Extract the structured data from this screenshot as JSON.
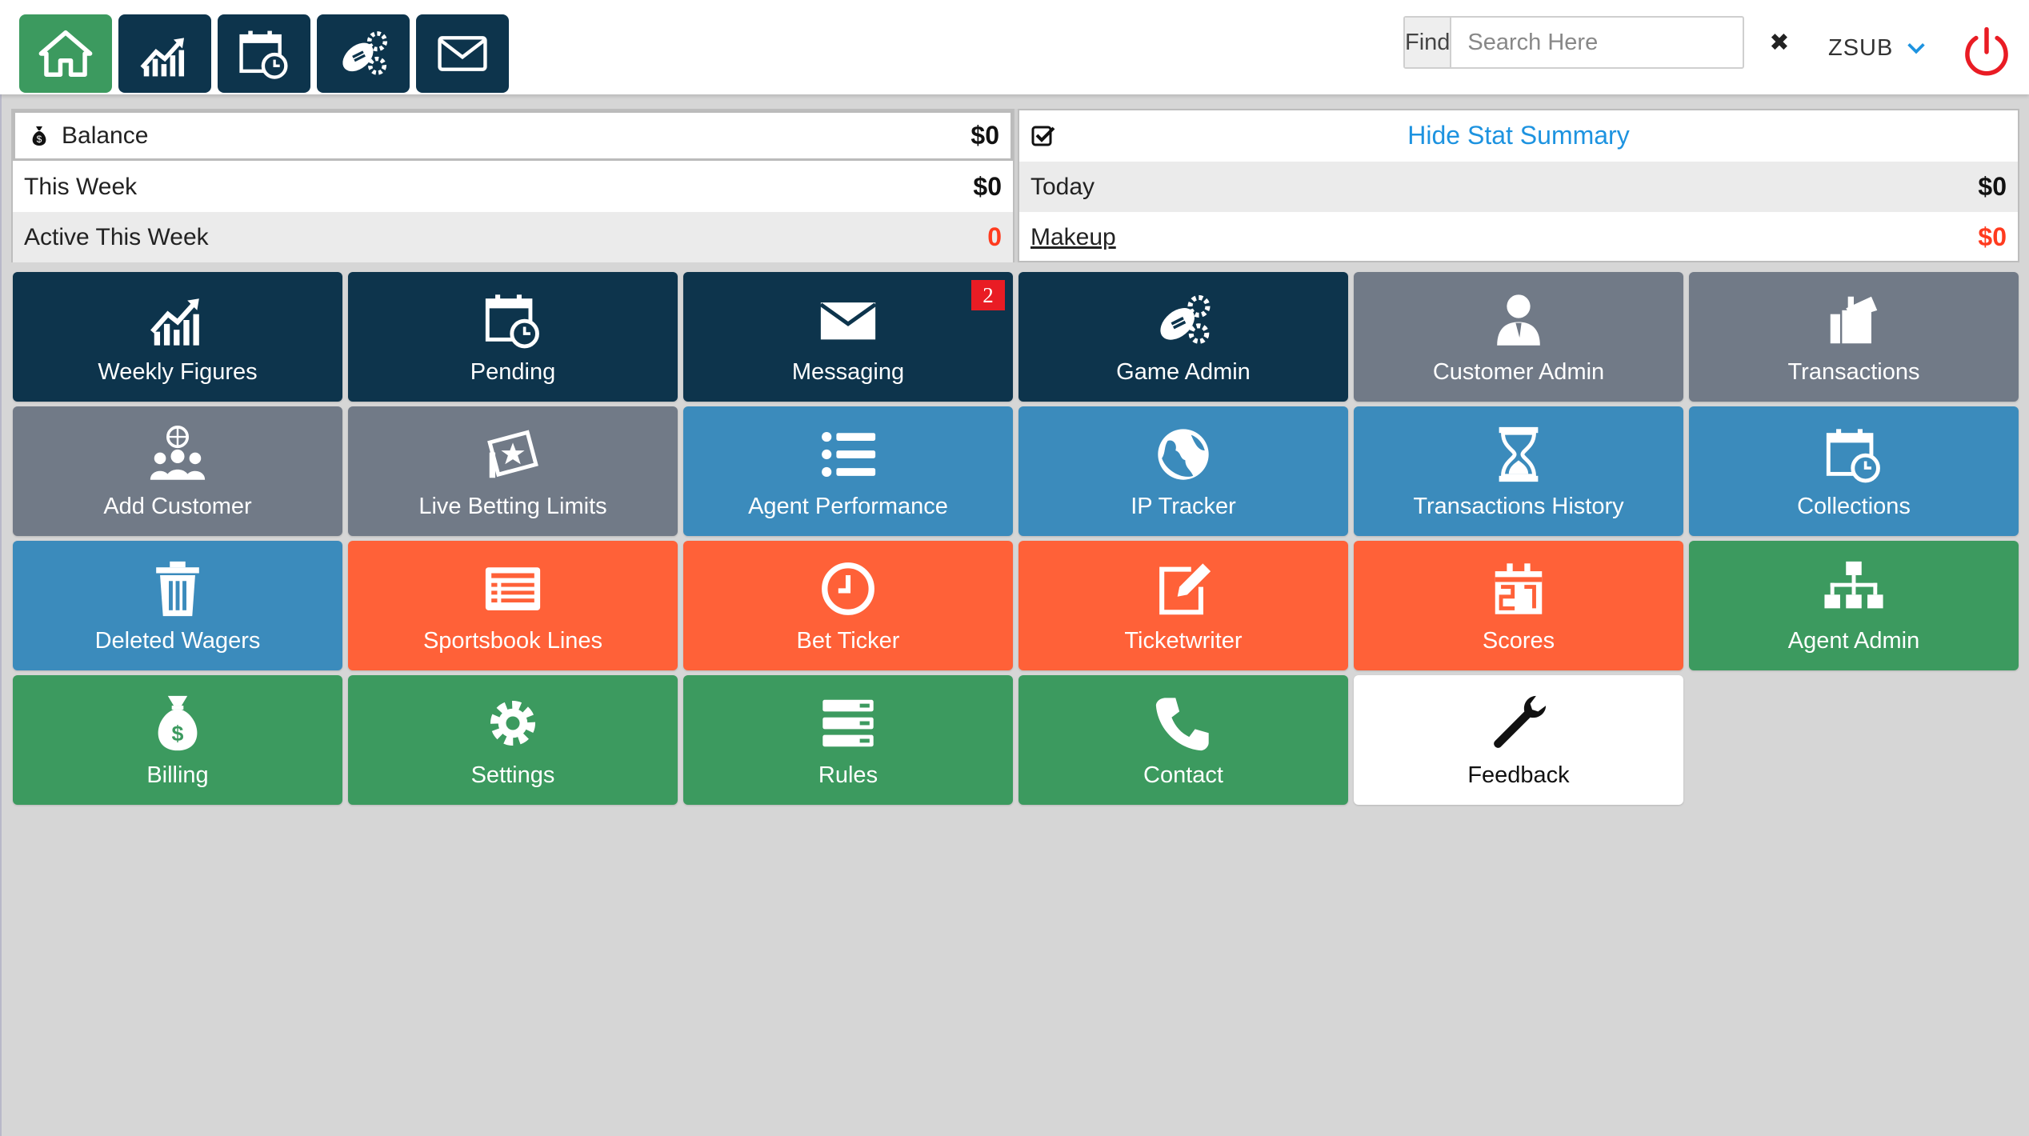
{
  "colors": {
    "navy": "#0d344c",
    "green": "#3c9a5f",
    "grey": "#717a87",
    "blue": "#3b8bbc",
    "orange": "#ff6138",
    "link": "#1d93e0",
    "alert_red": "#e91c24"
  },
  "topnav": {
    "buttons": [
      {
        "name": "home",
        "icon": "home-icon"
      },
      {
        "name": "weekly-figures",
        "icon": "chart-up-icon"
      },
      {
        "name": "pending",
        "icon": "calendar-clock-icon"
      },
      {
        "name": "game-admin",
        "icon": "football-gears-icon"
      },
      {
        "name": "messaging",
        "icon": "envelope-icon"
      }
    ],
    "find_label": "Find",
    "search_placeholder": "Search Here",
    "clear_symbol": "✖",
    "user": "ZSUB"
  },
  "stats": {
    "balance_label": "Balance",
    "balance_value": "$0",
    "this_week_label": "This Week",
    "this_week_value": "$0",
    "active_label": "Active This Week",
    "active_value": "0",
    "hide_link": "Hide Stat Summary",
    "today_label": "Today",
    "today_value": "$0",
    "makeup_label": "Makeup",
    "makeup_value": "$0"
  },
  "tiles": [
    {
      "label": "Weekly Figures",
      "icon": "chart-up-icon",
      "color": "navy"
    },
    {
      "label": "Pending",
      "icon": "calendar-clock-icon",
      "color": "navy"
    },
    {
      "label": "Messaging",
      "icon": "envelope-icon",
      "color": "navy",
      "badge": "2"
    },
    {
      "label": "Game Admin",
      "icon": "football-gears-icon",
      "color": "navy"
    },
    {
      "label": "Customer Admin",
      "icon": "user-tie-icon",
      "color": "grey"
    },
    {
      "label": "Transactions",
      "icon": "tickets-icon",
      "color": "grey"
    },
    {
      "label": "Add Customer",
      "icon": "users-globe-icon",
      "color": "grey"
    },
    {
      "label": "Live Betting Limits",
      "icon": "ticket-star-icon",
      "color": "grey"
    },
    {
      "label": "Agent Performance",
      "icon": "list-icon",
      "color": "blue"
    },
    {
      "label": "IP Tracker",
      "icon": "globe-icon",
      "color": "blue"
    },
    {
      "label": "Transactions History",
      "icon": "hourglass-icon",
      "color": "blue"
    },
    {
      "label": "Collections",
      "icon": "calendar-clock-icon",
      "color": "blue"
    },
    {
      "label": "Deleted Wagers",
      "icon": "trash-icon",
      "color": "blue"
    },
    {
      "label": "Sportsbook Lines",
      "icon": "newspaper-icon",
      "color": "orange"
    },
    {
      "label": "Bet Ticker",
      "icon": "clock-icon",
      "color": "orange"
    },
    {
      "label": "Ticketwriter",
      "icon": "edit-icon",
      "color": "orange"
    },
    {
      "label": "Scores",
      "icon": "scoreboard-icon",
      "color": "orange"
    },
    {
      "label": "Agent Admin",
      "icon": "sitemap-icon",
      "color": "green"
    },
    {
      "label": "Billing",
      "icon": "money-bag-icon",
      "color": "green"
    },
    {
      "label": "Settings",
      "icon": "gear-icon",
      "color": "green"
    },
    {
      "label": "Rules",
      "icon": "server-icon",
      "color": "green"
    },
    {
      "label": "Contact",
      "icon": "phone-icon",
      "color": "green"
    },
    {
      "label": "Feedback",
      "icon": "wrench-icon",
      "color": "white"
    }
  ]
}
